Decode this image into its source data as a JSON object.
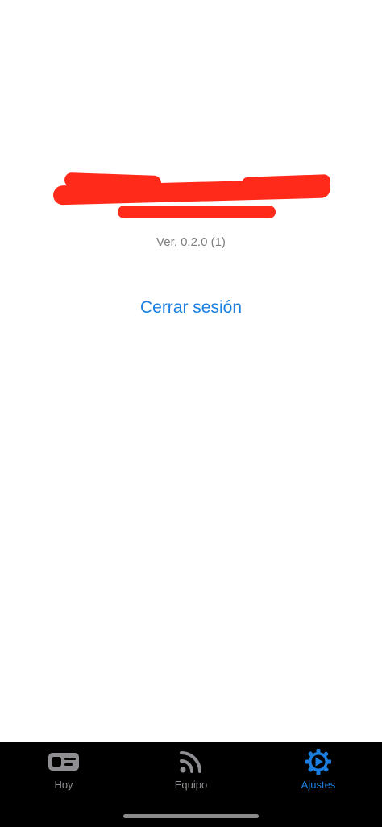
{
  "profile": {
    "name": "",
    "email": "",
    "version": "Ver. 0.2.0 (1)"
  },
  "actions": {
    "logout_label": "Cerrar sesión"
  },
  "tabbar": {
    "tabs": [
      {
        "label": "Hoy",
        "icon": "today-card-icon",
        "active": false
      },
      {
        "label": "Equipo",
        "icon": "feed-signal-icon",
        "active": false
      },
      {
        "label": "Ajustes",
        "icon": "settings-gear-icon",
        "active": true
      }
    ]
  },
  "colors": {
    "accent": "#1a7fe0",
    "inactive": "#8e8e93",
    "redaction": "#ff2a1a",
    "tabbar_bg": "#000000"
  }
}
